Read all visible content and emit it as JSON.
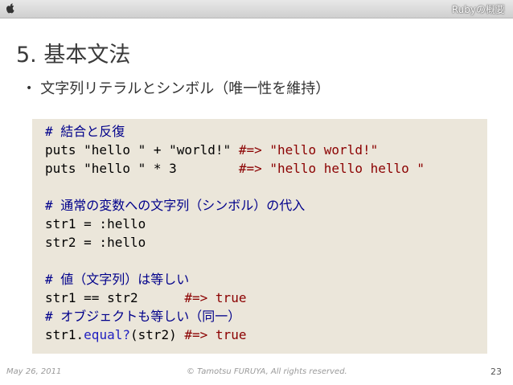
{
  "topbar": {
    "icon": "apple-icon",
    "title": "Rubyの概要"
  },
  "slide": {
    "title": "5. 基本文法",
    "bullet": "文字列リテラルとシンボル（唯一性を維持）"
  },
  "code": {
    "comment_concat": "# 結合と反復",
    "line_plus_code": "puts \"hello \" + \"world!\" ",
    "line_plus_result": "#=> \"hello world!\"",
    "line_times_code": "puts \"hello \" * 3        ",
    "line_times_result": "#=> \"hello hello hello \"",
    "comment_symbol": "# 通常の変数への文字列（シンボル）の代入",
    "assign_str1": "str1 = :hello",
    "assign_str2": "str2 = :hello",
    "comment_equal": "# 値（文字列）は等しい",
    "compare_code": "str1 == str2      ",
    "compare_result": "#=> true",
    "comment_identity": "# オブジェクトも等しい（同一）",
    "identity_receiver": "str1.",
    "identity_method": "equal?",
    "identity_args": "(str2) ",
    "identity_result": "#=> true"
  },
  "footer": {
    "date": "May 26, 2011",
    "copyright": "© Tamotsu FURUYA, All rights reserved.",
    "page": "23"
  },
  "colors": {
    "code_background": "#ebe6da",
    "comment": "#00008b",
    "result": "#8b0000",
    "method": "#2020c0"
  }
}
